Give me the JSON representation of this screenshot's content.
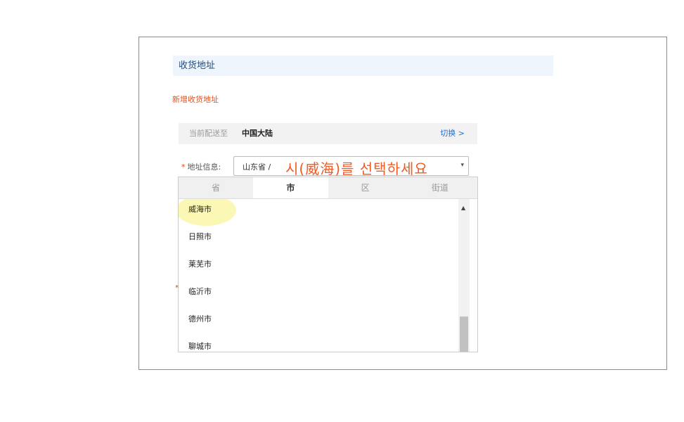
{
  "section_title": "收货地址",
  "add_address_link": "新增收货地址",
  "delivery": {
    "label": "当前配送至",
    "value": "中国大陆",
    "switch_label": "切换 >"
  },
  "address_info": {
    "required_mark": "*",
    "label": "地址信息:",
    "selected_text": "山东省 /",
    "caret": "▾"
  },
  "overlay_instruction": "시(威海)를 선택하세요",
  "region_tabs": [
    {
      "label": "省",
      "active": false
    },
    {
      "label": "市",
      "active": true
    },
    {
      "label": "区",
      "active": false
    },
    {
      "label": "街道",
      "active": false
    }
  ],
  "cities": [
    "威海市",
    "日照市",
    "莱芜市",
    "临沂市",
    "德州市",
    "聊城市"
  ],
  "scroll_up_glyph": "▲",
  "colors": {
    "accent_link": "#2a6fc9",
    "orange": "#e0501e",
    "highlight": "#fbf7b4"
  }
}
